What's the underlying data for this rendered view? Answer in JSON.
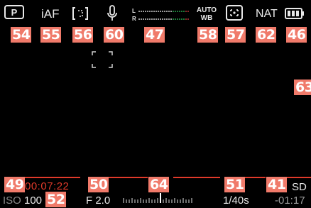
{
  "top_bar": {
    "program_mode": {
      "icon": "program-mode-icon",
      "glyph": "P",
      "callout": "54"
    },
    "focus_mode": {
      "label": "iAF",
      "callout": "55"
    },
    "metering": {
      "icon": "metering-icon",
      "callout": "56"
    },
    "microphone": {
      "icon": "microphone-icon",
      "callout": "60"
    },
    "audio_level": {
      "channel_left": "L",
      "channel_right": "R",
      "callout": "47"
    },
    "white_balance": {
      "line1": "AUTO",
      "line2": "WB",
      "callout": "58"
    },
    "af_area": {
      "icon": "af-area-icon",
      "callout": "57"
    },
    "film_style": {
      "label": "NAT",
      "callout": "62"
    },
    "battery": {
      "icon": "battery-icon",
      "callout": "46"
    }
  },
  "viewfinder": {
    "af_frame": {
      "icon": "af-frame-icon"
    },
    "side_callout": "63"
  },
  "bottom_bar": {
    "callouts": {
      "rec_indicator": "49",
      "aperture": "50",
      "exposure_scale": "64",
      "shutter": "51",
      "remaining": "41",
      "card": "52"
    },
    "timecode": "00:07:22",
    "storage": "SD",
    "iso_label": "ISO",
    "iso_value": "100",
    "aperture": "F 2.0",
    "shutter": "1/40s",
    "remaining": "-01:17"
  },
  "colors": {
    "accent_red": "#e03a2a",
    "callout_bg": "#f07a6a",
    "level_green": "#1f7a3a"
  }
}
